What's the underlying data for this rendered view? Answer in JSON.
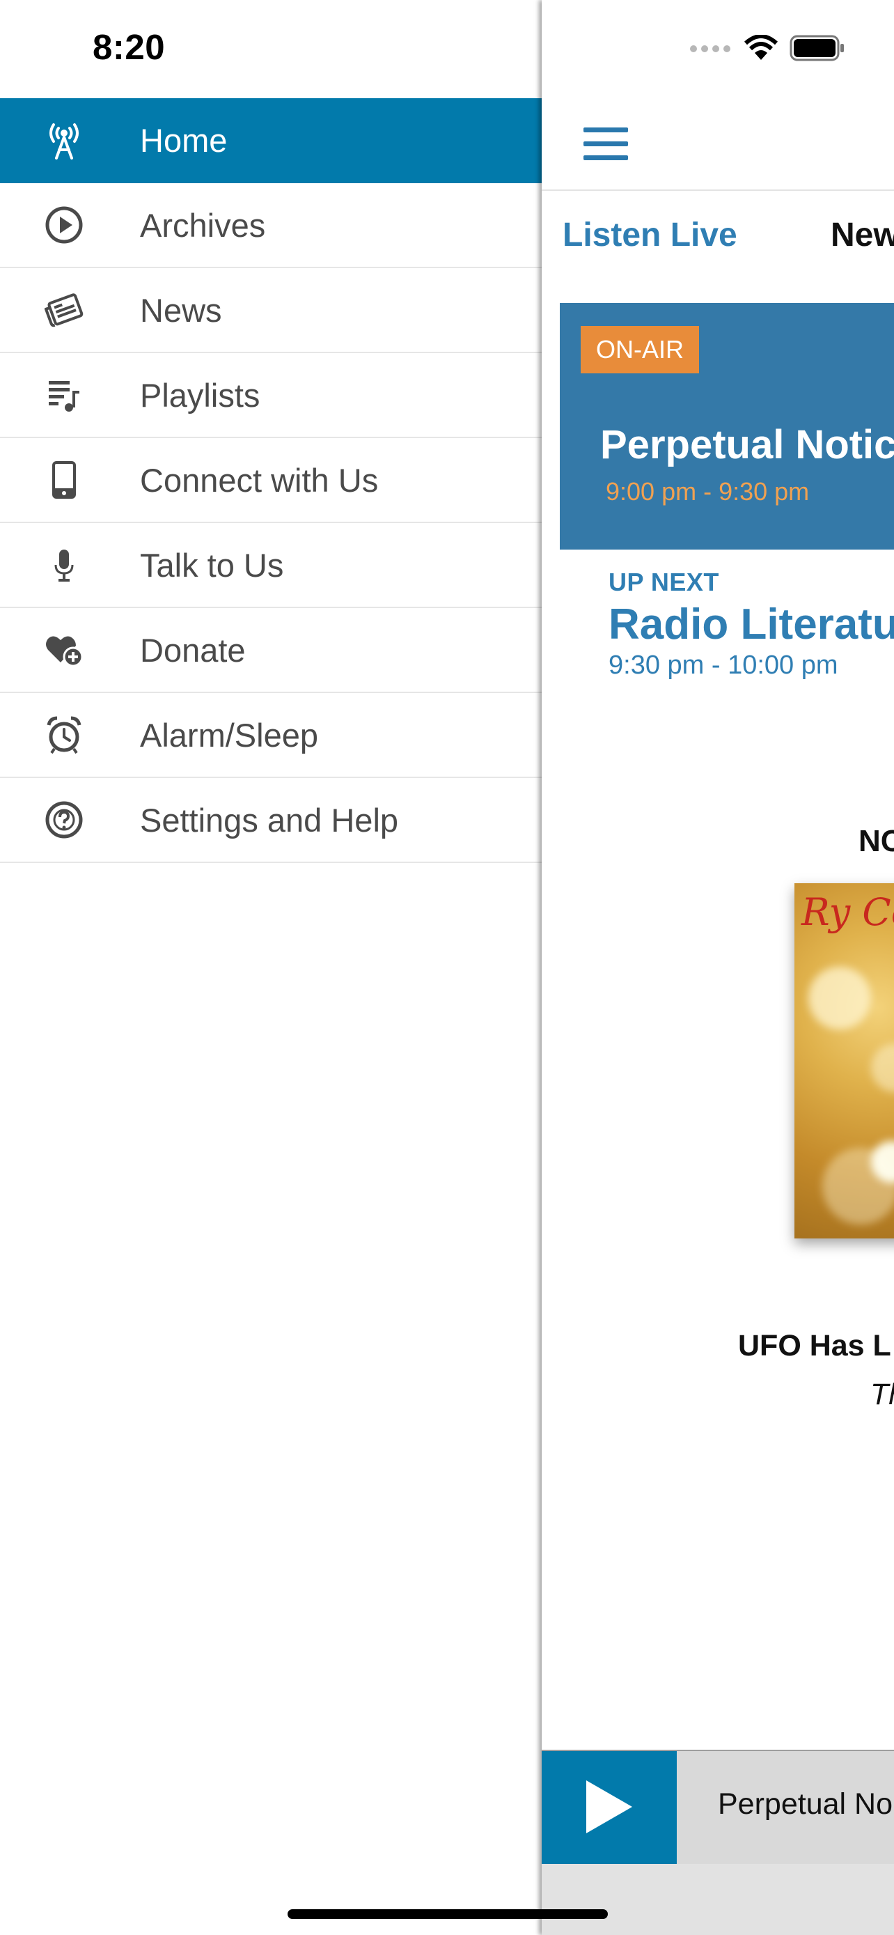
{
  "status_bar": {
    "time": "8:20",
    "icons": [
      "signal-dots-icon",
      "wifi-icon",
      "battery-icon"
    ]
  },
  "drawer": {
    "items": [
      {
        "label": "Home",
        "icon": "radio-tower-icon",
        "active": true
      },
      {
        "label": "Archives",
        "icon": "play-circle-icon",
        "active": false
      },
      {
        "label": "News",
        "icon": "newspaper-icon",
        "active": false
      },
      {
        "label": "Playlists",
        "icon": "playlist-icon",
        "active": false
      },
      {
        "label": "Connect with Us",
        "icon": "phone-icon",
        "active": false
      },
      {
        "label": "Talk to Us",
        "icon": "microphone-icon",
        "active": false
      },
      {
        "label": "Donate",
        "icon": "heart-plus-icon",
        "active": false
      },
      {
        "label": "Alarm/Sleep",
        "icon": "alarm-clock-icon",
        "active": false
      },
      {
        "label": "Settings and Help",
        "icon": "help-circle-icon",
        "active": false
      }
    ]
  },
  "main": {
    "tabs": [
      {
        "label": "Listen Live"
      },
      {
        "label": "New"
      }
    ],
    "on_air": {
      "badge": "ON-AIR",
      "title": "Perpetual Notic",
      "time": "9:00 pm - 9:30 pm"
    },
    "up_next": {
      "label": "UP NEXT",
      "title": "Radio Literatu",
      "time": "9:30 pm - 10:00 pm"
    },
    "now_playing": {
      "label": "NC",
      "album_text": "Ry Co",
      "track_title": "UFO Has L",
      "track_artist": "Th"
    },
    "player": {
      "title": "Perpetual No"
    }
  },
  "colors": {
    "brand_blue": "#027aab",
    "card_blue": "#3479a8",
    "text_blue": "#2f7eb3",
    "onair_orange": "#e88c3a",
    "time_orange": "#f0a151"
  }
}
